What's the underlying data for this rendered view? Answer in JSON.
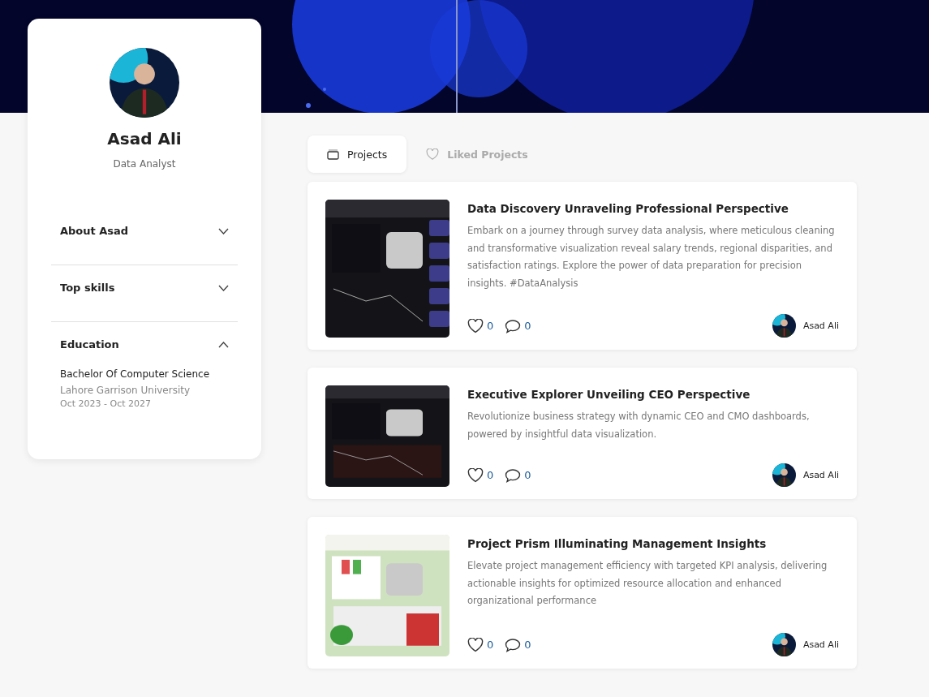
{
  "profile": {
    "name": "Asad Ali",
    "role": "Data Analyst",
    "sections": [
      {
        "title": "About Asad",
        "expanded": false
      },
      {
        "title": "Top skills",
        "expanded": false
      },
      {
        "title": "Education",
        "expanded": true,
        "entries": [
          {
            "degree": "Bachelor Of Computer Science",
            "school": "Lahore Garrison University",
            "dates": "Oct 2023 - Oct 2027"
          }
        ]
      }
    ]
  },
  "tabs": [
    {
      "label": "Projects",
      "selected": true
    },
    {
      "label": "Liked Projects",
      "selected": false
    }
  ],
  "projects": [
    {
      "title": "Data Discovery Unraveling Professional Perspective",
      "description": "Embark on a journey through survey data analysis, where meticulous cleaning and transformative visualization reveal salary trends, regional disparities, and satisfaction ratings. Explore the power of data preparation for precision insights. #DataAnalysis",
      "likes": "0",
      "comments": "0",
      "author": "Asad Ali"
    },
    {
      "title": "Executive Explorer Unveiling CEO Perspective",
      "description": "Revolutionize business strategy with dynamic CEO and CMO dashboards, powered by insightful data visualization.",
      "likes": "0",
      "comments": "0",
      "author": "Asad Ali"
    },
    {
      "title": "Project Prism Illuminating Management Insights",
      "description": "Elevate project management efficiency with targeted KPI analysis, delivering actionable insights for optimized resource allocation and enhanced organizational performance",
      "likes": "0",
      "comments": "0",
      "author": "Asad Ali"
    }
  ]
}
